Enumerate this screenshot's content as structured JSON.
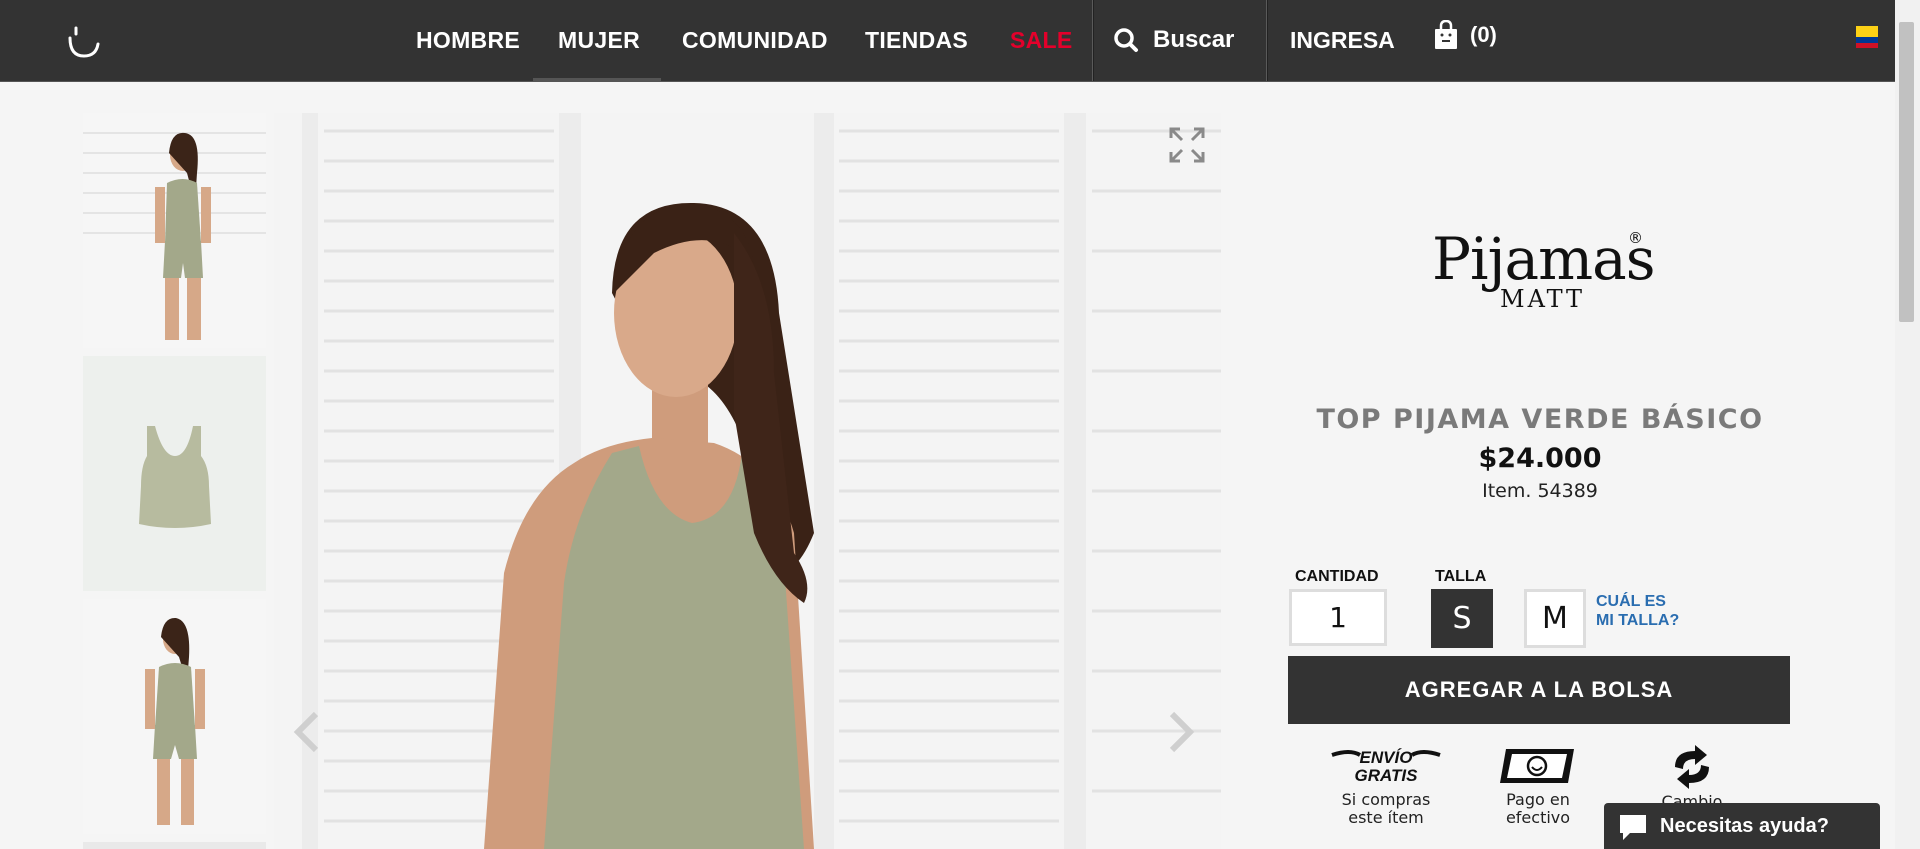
{
  "nav": {
    "items": [
      {
        "label": "HOMBRE"
      },
      {
        "label": "MUJER"
      },
      {
        "label": "COMUNIDAD"
      },
      {
        "label": "TIENDAS"
      },
      {
        "label": "SALE"
      }
    ],
    "search_label": "Buscar",
    "login_label": "INGRESA",
    "cart_count": "(0)",
    "flag_colors": [
      "#fcd116",
      "#003893",
      "#ce1126"
    ]
  },
  "brand": {
    "name": "Pijamas",
    "sub": "MATT",
    "mark": "®"
  },
  "product": {
    "title": "TOP PIJAMA VERDE BÁSICO",
    "price": "$24.000",
    "item": "Item. 54389",
    "quantity_label": "CANTIDAD",
    "quantity_value": "1",
    "size_label": "TALLA",
    "sizes": [
      {
        "label": "S",
        "selected": true
      },
      {
        "label": "M",
        "selected": false
      }
    ],
    "size_help_line1": "CUÁL ES",
    "size_help_line2": "MI TALLA?",
    "add_button": "AGREGAR A LA BOLSA"
  },
  "benefits": [
    {
      "icon": "envio-gratis-icon",
      "icon_text_1": "ENVÍO",
      "icon_text_2": "GRATIS",
      "cap1": "Si compras",
      "cap2": "este ítem"
    },
    {
      "icon": "cash-payment-icon",
      "cap1": "Pago en",
      "cap2": "efectivo"
    },
    {
      "icon": "exchange-arrows-icon",
      "cap1": "Cambio",
      "cap2": ""
    }
  ],
  "chat": {
    "label": "Necesitas ayuda?"
  },
  "colors": {
    "nav_bg": "#333333",
    "sale": "#e4002b",
    "link": "#2a6db0",
    "garment": "#a3a88a"
  }
}
